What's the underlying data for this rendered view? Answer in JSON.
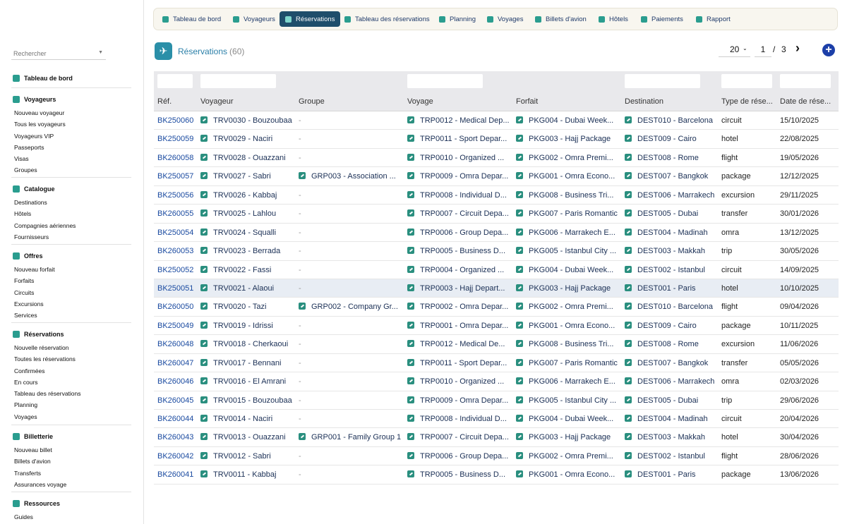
{
  "search": {
    "placeholder": "Rechercher"
  },
  "sidebar": {
    "sections": [
      {
        "title": "Tableau de bord",
        "icon": "dashboard-icon",
        "items": []
      },
      {
        "title": "Voyageurs",
        "icon": "user-icon",
        "items": [
          "Nouveau voyageur",
          "Tous les voyageurs",
          "Voyageurs VIP",
          "Passeports",
          "Visas",
          "Groupes"
        ]
      },
      {
        "title": "Catalogue",
        "icon": "catalog-icon",
        "items": [
          "Destinations",
          "Hôtels",
          "Compagnies aériennes",
          "Fournisseurs"
        ]
      },
      {
        "title": "Offres",
        "icon": "offer-icon",
        "items": [
          "Nouveau forfait",
          "Forfaits",
          "Circuits",
          "Excursions",
          "Services"
        ]
      },
      {
        "title": "Réservations",
        "icon": "reservation-icon",
        "items": [
          "Nouvelle réservation",
          "Toutes les réservations",
          "Confirmées",
          "En cours",
          "Tableau des réservations",
          "Planning",
          "Voyages"
        ]
      },
      {
        "title": "Billetterie",
        "icon": "plane-icon",
        "items": [
          "Nouveau billet",
          "Billets d'avion",
          "Transferts",
          "Assurances voyage"
        ]
      },
      {
        "title": "Ressources",
        "icon": "resources-icon",
        "items": [
          "Guides"
        ]
      }
    ]
  },
  "topnav": [
    {
      "label": "Tableau de bord",
      "icon": "dashboard-icon",
      "active": false
    },
    {
      "label": "Voyageurs",
      "icon": "user-icon",
      "active": false
    },
    {
      "label": "Réservations",
      "icon": "reservation-icon",
      "active": true
    },
    {
      "label": "Tableau des réservations",
      "icon": "list-icon",
      "active": false
    },
    {
      "label": "Planning",
      "icon": "calendar-icon",
      "active": false
    },
    {
      "label": "Voyages",
      "icon": "globe-icon",
      "active": false
    },
    {
      "label": "Billets d'avion",
      "icon": "plane-icon",
      "active": false
    },
    {
      "label": "Hôtels",
      "icon": "hotel-icon",
      "active": false
    },
    {
      "label": "Paiements",
      "icon": "payment-icon",
      "active": false
    },
    {
      "label": "Rapport",
      "icon": "report-icon",
      "active": false
    }
  ],
  "header": {
    "title": "Réservations",
    "count": "(60)",
    "icon": "plane-icon"
  },
  "pagination": {
    "per_page": "20",
    "current": "1",
    "separator": "/",
    "total": "3",
    "next_icon": "chevron-right-icon",
    "add_icon": "plus-icon"
  },
  "table": {
    "columns": [
      "Réf.",
      "Voyageur",
      "Groupe",
      "Voyage",
      "Forfait",
      "Destination",
      "Type de rése...",
      "Date de rése..."
    ],
    "rows": [
      [
        "BK250060",
        "TRV0030 - Bouzoubaa",
        "-",
        "TRP0012 - Medical Dep...",
        "PKG004 - Dubai Week...",
        "DEST010 - Barcelona",
        "circuit",
        "15/10/2025"
      ],
      [
        "BK250059",
        "TRV0029 - Naciri",
        "-",
        "TRP0011 - Sport Depar...",
        "PKG003 - Hajj Package",
        "DEST009 - Cairo",
        "hotel",
        "22/08/2025"
      ],
      [
        "BK260058",
        "TRV0028 - Ouazzani",
        "-",
        "TRP0010 - Organized ...",
        "PKG002 - Omra Premi...",
        "DEST008 - Rome",
        "flight",
        "19/05/2026"
      ],
      [
        "BK250057",
        "TRV0027 - Sabri",
        "GRP003 - Association ...",
        "TRP0009 - Omra Depar...",
        "PKG001 - Omra Econo...",
        "DEST007 - Bangkok",
        "package",
        "12/12/2025"
      ],
      [
        "BK250056",
        "TRV0026 - Kabbaj",
        "-",
        "TRP0008 - Individual D...",
        "PKG008 - Business Tri...",
        "DEST006 - Marrakech",
        "excursion",
        "29/11/2025"
      ],
      [
        "BK260055",
        "TRV0025 - Lahlou",
        "-",
        "TRP0007 - Circuit Depa...",
        "PKG007 - Paris Romantic",
        "DEST005 - Dubai",
        "transfer",
        "30/01/2026"
      ],
      [
        "BK250054",
        "TRV0024 - Squalli",
        "-",
        "TRP0006 - Group Depa...",
        "PKG006 - Marrakech E...",
        "DEST004 - Madinah",
        "omra",
        "13/12/2025"
      ],
      [
        "BK260053",
        "TRV0023 - Berrada",
        "-",
        "TRP0005 - Business D...",
        "PKG005 - Istanbul City ...",
        "DEST003 - Makkah",
        "trip",
        "30/05/2026"
      ],
      [
        "BK250052",
        "TRV0022 - Fassi",
        "-",
        "TRP0004 - Organized ...",
        "PKG004 - Dubai Week...",
        "DEST002 - Istanbul",
        "circuit",
        "14/09/2025"
      ],
      [
        "BK250051",
        "TRV0021 - Alaoui",
        "-",
        "TRP0003 - Hajj Depart...",
        "PKG003 - Hajj Package",
        "DEST001 - Paris",
        "hotel",
        "10/10/2025"
      ],
      [
        "BK260050",
        "TRV0020 - Tazi",
        "GRP002 - Company Gr...",
        "TRP0002 - Omra Depar...",
        "PKG002 - Omra Premi...",
        "DEST010 - Barcelona",
        "flight",
        "09/04/2026"
      ],
      [
        "BK250049",
        "TRV0019 - Idrissi",
        "-",
        "TRP0001 - Omra Depar...",
        "PKG001 - Omra Econo...",
        "DEST009 - Cairo",
        "package",
        "10/11/2025"
      ],
      [
        "BK260048",
        "TRV0018 - Cherkaoui",
        "-",
        "TRP0012 - Medical De...",
        "PKG008 - Business Tri...",
        "DEST008 - Rome",
        "excursion",
        "11/06/2026"
      ],
      [
        "BK260047",
        "TRV0017 - Bennani",
        "-",
        "TRP0011 - Sport Depar...",
        "PKG007 - Paris Romantic",
        "DEST007 - Bangkok",
        "transfer",
        "05/05/2026"
      ],
      [
        "BK260046",
        "TRV0016 - El Amrani",
        "-",
        "TRP0010 - Organized ...",
        "PKG006 - Marrakech E...",
        "DEST006 - Marrakech",
        "omra",
        "02/03/2026"
      ],
      [
        "BK260045",
        "TRV0015 - Bouzoubaa",
        "-",
        "TRP0009 - Omra Depar...",
        "PKG005 - Istanbul City ...",
        "DEST005 - Dubai",
        "trip",
        "29/06/2026"
      ],
      [
        "BK260044",
        "TRV0014 - Naciri",
        "-",
        "TRP0008 - Individual D...",
        "PKG004 - Dubai Week...",
        "DEST004 - Madinah",
        "circuit",
        "20/04/2026"
      ],
      [
        "BK260043",
        "TRV0013 - Ouazzani",
        "GRP001 - Family Group 1",
        "TRP0007 - Circuit Depa...",
        "PKG003 - Hajj Package",
        "DEST003 - Makkah",
        "hotel",
        "30/04/2026"
      ],
      [
        "BK260042",
        "TRV0012 - Sabri",
        "-",
        "TRP0006 - Group Depa...",
        "PKG002 - Omra Premi...",
        "DEST002 - Istanbul",
        "flight",
        "28/06/2026"
      ],
      [
        "BK260041",
        "TRV0011 - Kabbaj",
        "-",
        "TRP0005 - Business D...",
        "PKG001 - Omra Econo...",
        "DEST001 - Paris",
        "package",
        "13/06/2026"
      ]
    ],
    "highlighted_row": 9
  },
  "colors": {
    "accent": "#2a9d8f",
    "nav_active": "#1f4e6b",
    "link": "#1a4aa0",
    "add_button": "#1c3fa8"
  }
}
